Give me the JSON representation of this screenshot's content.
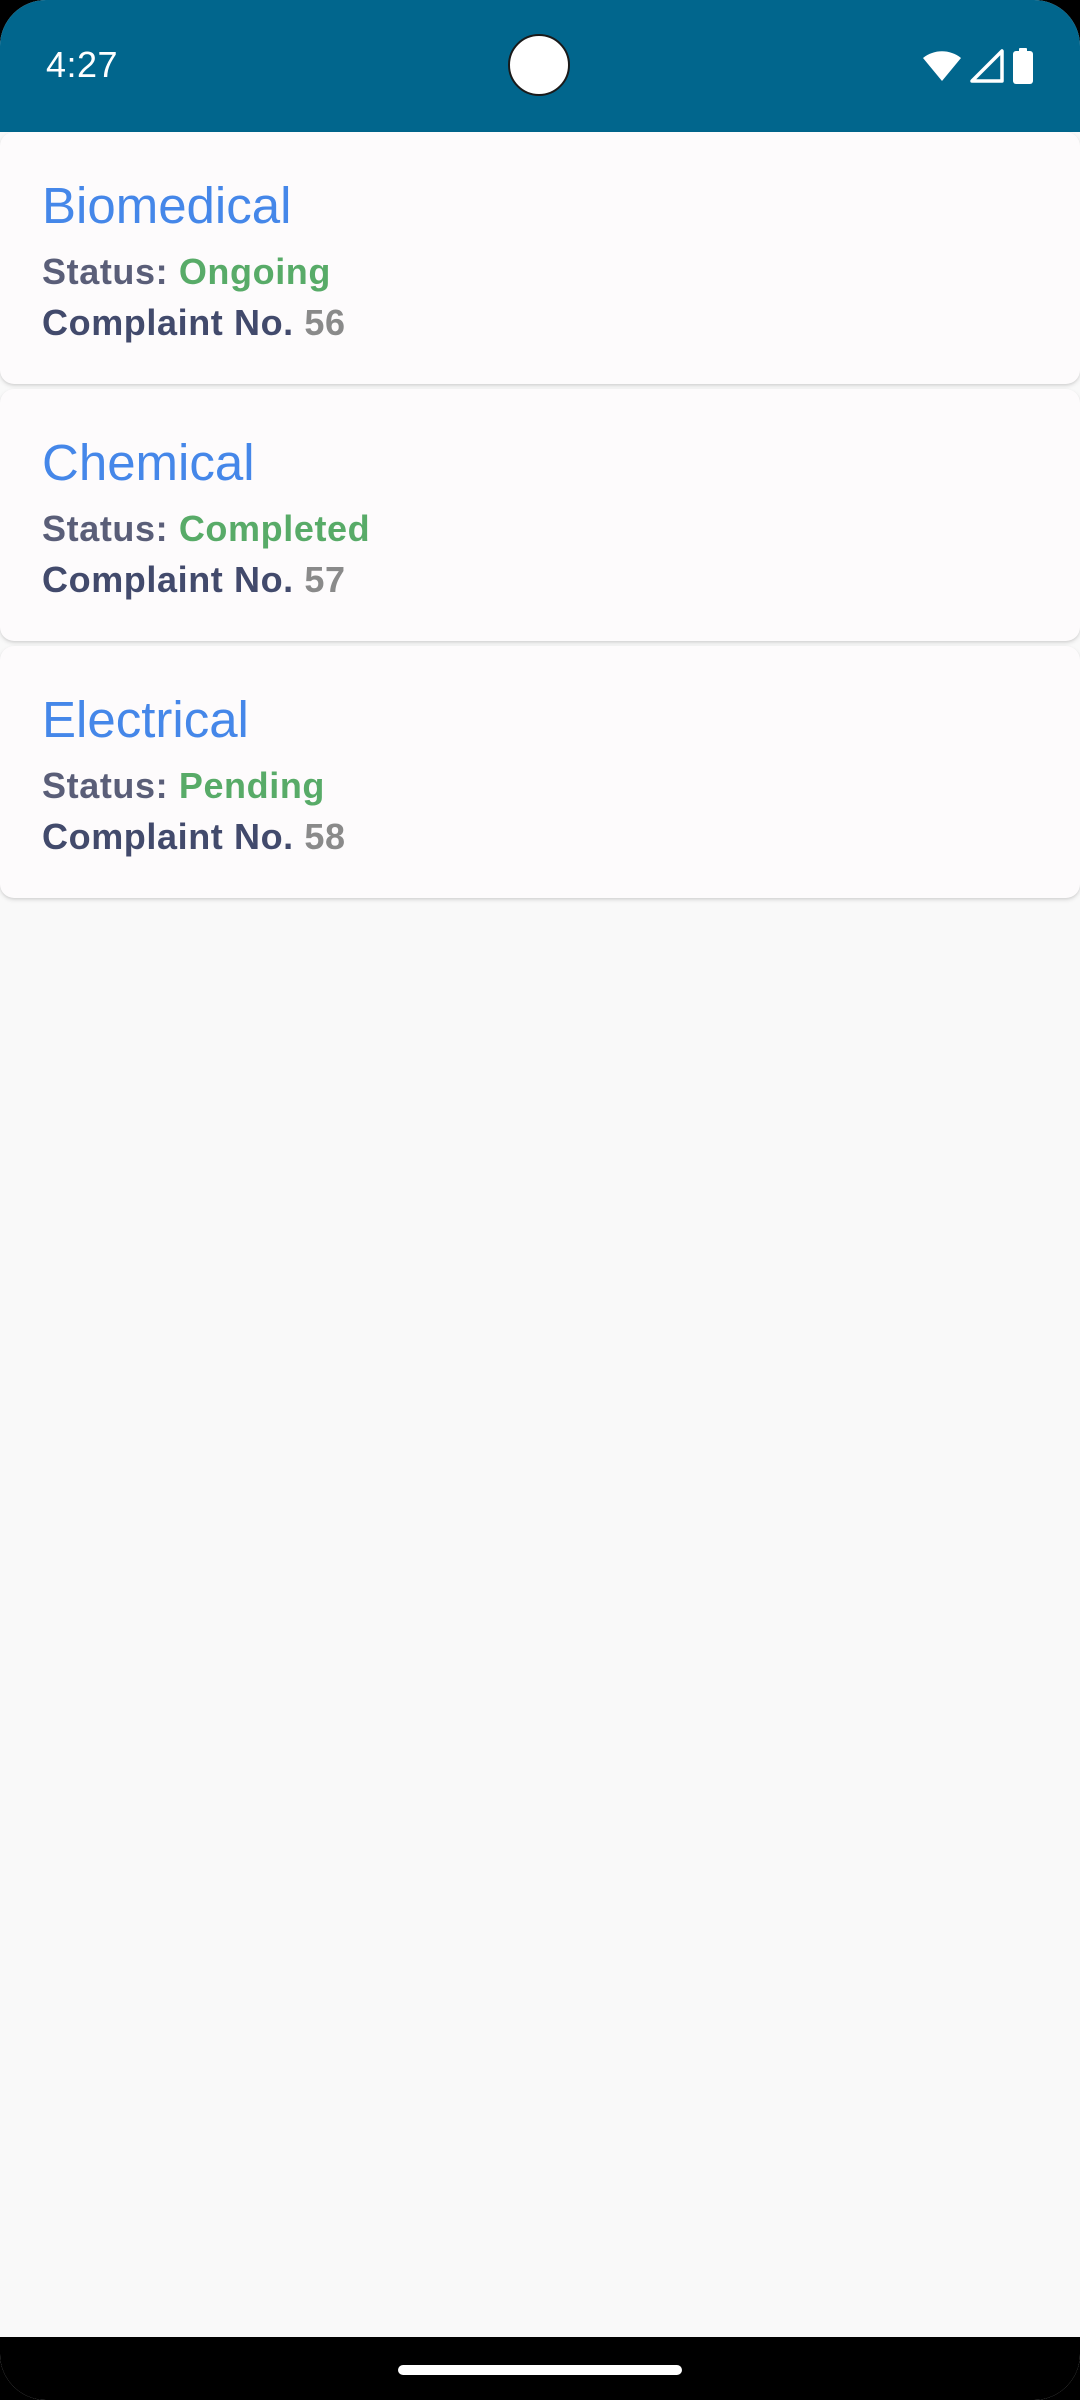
{
  "status_bar": {
    "time": "4:27",
    "icons": [
      "wifi-icon",
      "cell-signal-icon",
      "battery-icon"
    ]
  },
  "complaints": [
    {
      "title": "Biomedical",
      "status_label": "Status:",
      "status_value": "Ongoing",
      "complaint_label": "Complaint No.",
      "complaint_number": "56"
    },
    {
      "title": "Chemical",
      "status_label": "Status:",
      "status_value": "Completed",
      "complaint_label": "Complaint No.",
      "complaint_number": "57"
    },
    {
      "title": "Electrical",
      "status_label": "Status:",
      "status_value": "Pending",
      "complaint_label": "Complaint No.",
      "complaint_number": "58"
    }
  ],
  "colors": {
    "status_bar_bg": "#01668d",
    "title": "#4587e9",
    "status_value": "#58ab68",
    "complaint_number": "#8a8a8a",
    "background": "#f9f9f9"
  }
}
